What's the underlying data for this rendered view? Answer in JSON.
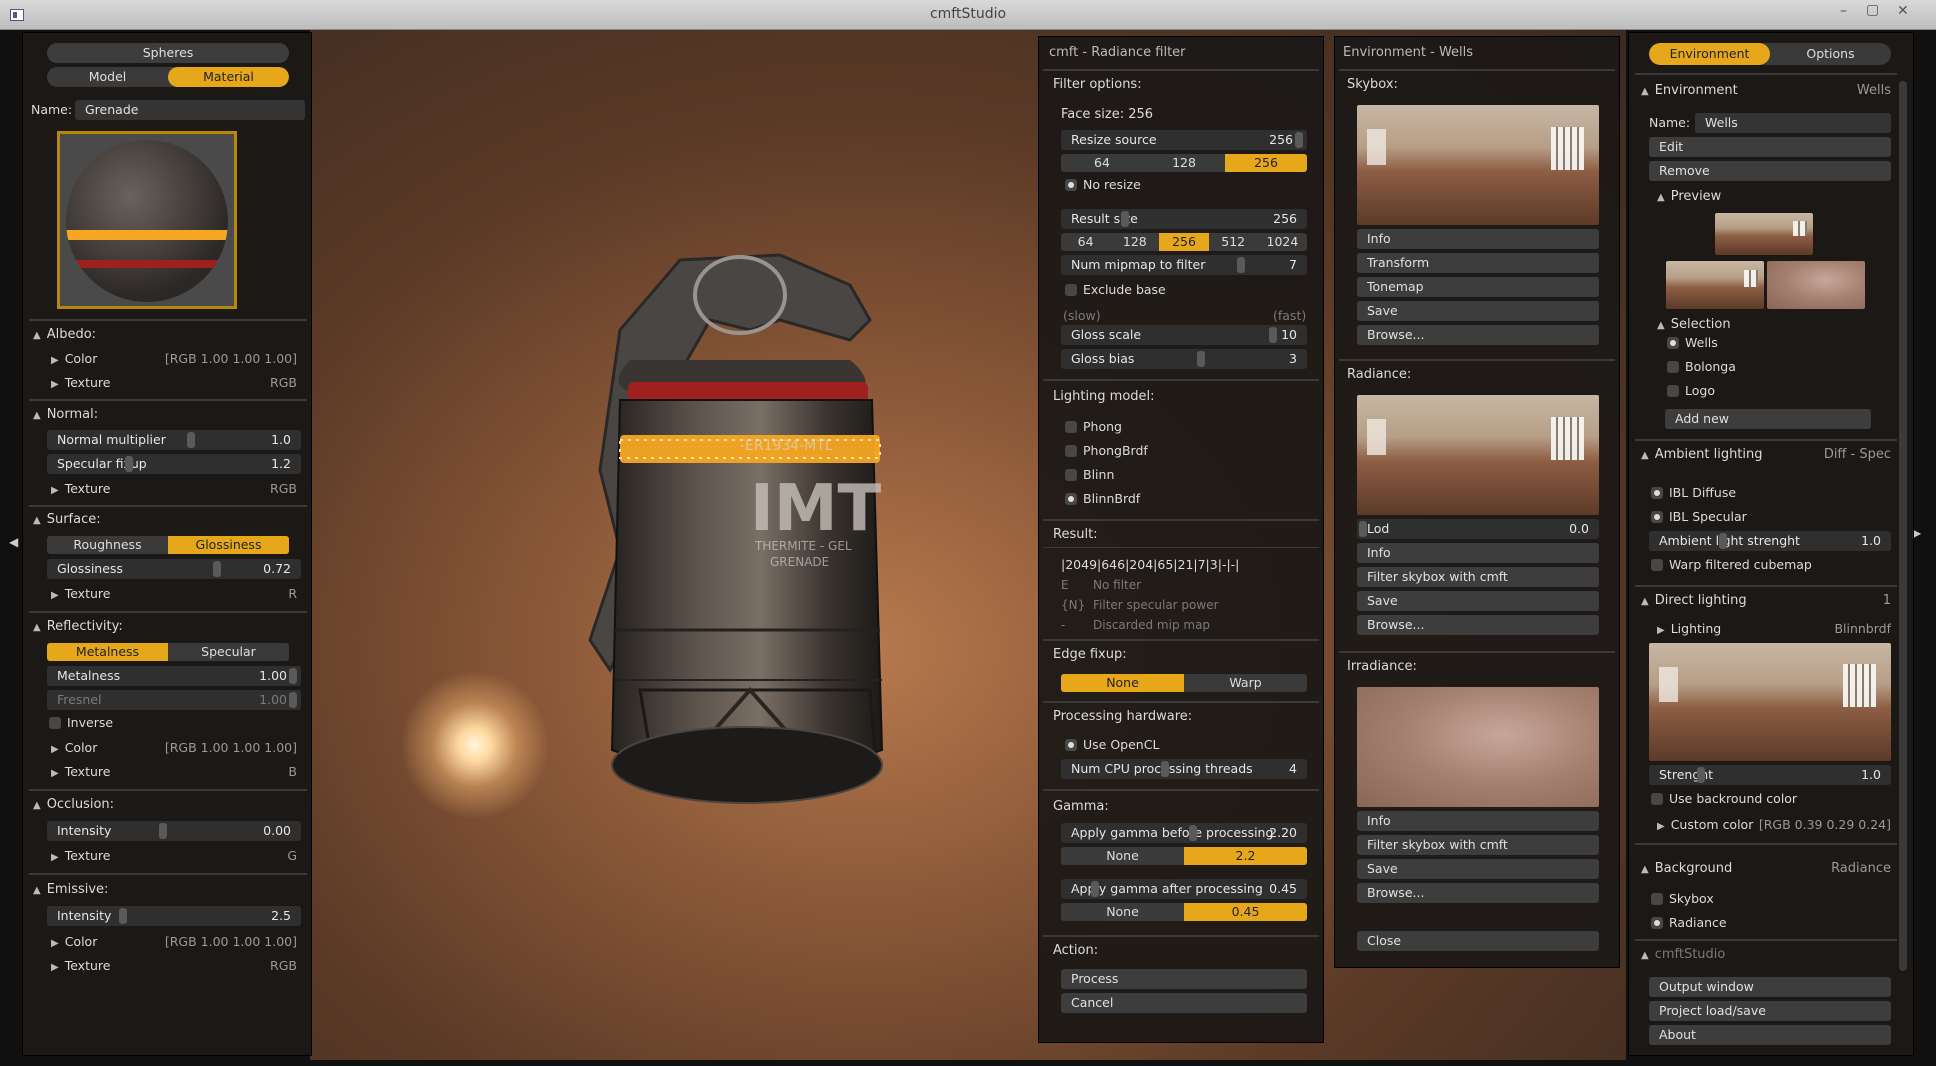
{
  "window": {
    "title": "cmftStudio"
  },
  "left": {
    "tabs": {
      "spheres": "Spheres",
      "model": "Model",
      "material": "Material"
    },
    "name_label": "Name:",
    "name_value": "Grenade",
    "albedo": {
      "title": "Albedo:",
      "color_label": "Color",
      "color_value": "[RGB 1.00 1.00 1.00]",
      "texture_label": "Texture",
      "texture_value": "RGB"
    },
    "normal": {
      "title": "Normal:",
      "mult_label": "Normal multiplier",
      "mult_value": "1.0",
      "spec_label": "Specular fixup",
      "spec_value": "1.2",
      "texture_label": "Texture",
      "texture_value": "RGB"
    },
    "surface": {
      "title": "Surface:",
      "roughness": "Roughness",
      "glossiness": "Glossiness",
      "gloss_label": "Glossiness",
      "gloss_value": "0.72",
      "texture_label": "Texture",
      "texture_value": "R"
    },
    "reflectivity": {
      "title": "Reflectivity:",
      "metalness_tab": "Metalness",
      "specular_tab": "Specular",
      "metal_label": "Metalness",
      "metal_value": "1.00",
      "fresnel_label": "Fresnel",
      "fresnel_value": "1.00",
      "inverse_label": "Inverse",
      "color_label": "Color",
      "color_value": "[RGB 1.00 1.00 1.00]",
      "texture_label": "Texture",
      "texture_value": "B"
    },
    "occlusion": {
      "title": "Occlusion:",
      "intensity_label": "Intensity",
      "intensity_value": "0.00",
      "texture_label": "Texture",
      "texture_value": "G"
    },
    "emissive": {
      "title": "Emissive:",
      "intensity_label": "Intensity",
      "intensity_value": "2.5",
      "color_label": "Color",
      "color_value": "[RGB 1.00 1.00 1.00]",
      "texture_label": "Texture",
      "texture_value": "RGB"
    }
  },
  "grenade": {
    "imt": "IMT",
    "model": "-ER1934-MTL",
    "line1": "THERMITE - GEL",
    "line2": "GRENADE"
  },
  "radiance": {
    "title": "cmft - Radiance filter",
    "filter_options": "Filter options:",
    "face_size": "Face size: 256",
    "resize_label": "Resize source",
    "resize_value": "256",
    "resize_opts": [
      "64",
      "128",
      "256"
    ],
    "no_resize": "No resize",
    "result_label": "Result size",
    "result_value": "256",
    "result_opts": [
      "64",
      "128",
      "256",
      "512",
      "1024"
    ],
    "mip_label": "Num mipmap to filter",
    "mip_value": "7",
    "exclude": "Exclude base",
    "slow": "(slow)",
    "fast": "(fast)",
    "gloss_scale_label": "Gloss scale",
    "gloss_scale_value": "10",
    "gloss_bias_label": "Gloss bias",
    "gloss_bias_value": "3",
    "lighting_model": "Lighting model:",
    "models": [
      "Phong",
      "PhongBrdf",
      "Blinn",
      "BlinnBrdf"
    ],
    "result": "Result:",
    "result_line": "|2049|646|204|65|21|7|3|-|-|",
    "legend": [
      {
        "k": "E",
        "v": "No filter"
      },
      {
        "k": "{N}",
        "v": "Filter specular power"
      },
      {
        "k": "-",
        "v": "Discarded mip map"
      }
    ],
    "edge_fixup": "Edge fixup:",
    "edge_none": "None",
    "edge_warp": "Warp",
    "processing": "Processing hardware:",
    "opencl": "Use OpenCL",
    "threads_label": "Num CPU processing threads",
    "threads_value": "4",
    "gamma": "Gamma:",
    "gamma_before_label": "Apply gamma before processing",
    "gamma_before_value": "2.20",
    "gb_none": "None",
    "gb_val": "2.2",
    "gamma_after_label": "Apply gamma after processing",
    "gamma_after_value": "0.45",
    "ga_none": "None",
    "ga_val": "0.45",
    "action": "Action:",
    "process": "Process",
    "cancel": "Cancel"
  },
  "environment": {
    "title": "Environment - Wells",
    "skybox": "Skybox:",
    "sky_buttons": [
      "Info",
      "Transform",
      "Tonemap",
      "Save",
      "Browse..."
    ],
    "radiance": "Radiance:",
    "lod_label": "Lod",
    "lod_value": "0.0",
    "rad_buttons": [
      "Info",
      "Filter skybox with cmft",
      "Save",
      "Browse..."
    ],
    "irradiance": "Irradiance:",
    "irr_buttons": [
      "Info",
      "Filter skybox with cmft",
      "Save",
      "Browse..."
    ],
    "close": "Close"
  },
  "right": {
    "tab_env": "Environment",
    "tab_options": "Options",
    "env_title": "Environment",
    "env_name": "Wells",
    "name_label": "Name:",
    "name_value": "Wells",
    "edit": "Edit",
    "remove": "Remove",
    "preview": "Preview",
    "selection": "Selection",
    "sel_items": [
      "Wells",
      "Bolonga",
      "Logo"
    ],
    "add_new": "Add new",
    "ambient": "Ambient lighting",
    "ambient_mode": "Diff - Spec",
    "ibl_diffuse": "IBL Diffuse",
    "ibl_specular": "IBL Specular",
    "amb_label": "Ambient light strenght",
    "amb_value": "1.0",
    "warp": "Warp filtered cubemap",
    "direct": "Direct lighting",
    "direct_count": "1",
    "lighting": "Lighting",
    "lighting_value": "Blinnbrdf",
    "strength_label": "Strenght",
    "strength_value": "1.0",
    "use_bg": "Use backround color",
    "custom_color": "Custom color",
    "custom_value": "[RGB 0.39 0.29 0.24]",
    "background": "Background",
    "background_mode": "Radiance",
    "bg_skybox": "Skybox",
    "bg_radiance": "Radiance",
    "cmft": "cmftStudio",
    "output": "Output window",
    "project": "Project load/save",
    "about": "About"
  },
  "colors": {
    "accent": "#e6a81a",
    "panel": "#1c1816"
  }
}
